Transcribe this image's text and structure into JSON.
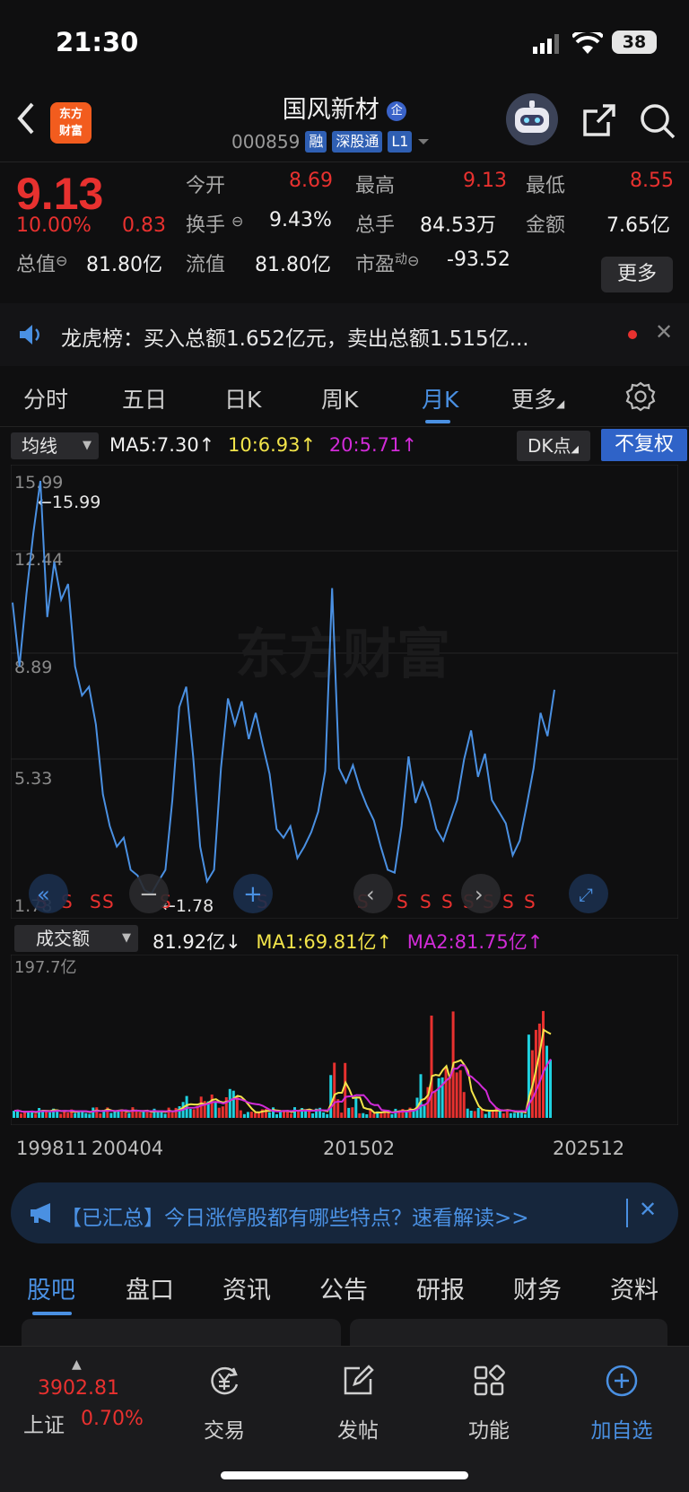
{
  "status_bar": {
    "time": "21:30",
    "battery": "38"
  },
  "header": {
    "logo_line1": "东方",
    "logo_line2": "财富",
    "stock_name": "国风新材",
    "stock_code": "000859",
    "tags": [
      "融",
      "深股通",
      "L1"
    ]
  },
  "quote": {
    "price": "9.13",
    "change_pct": "10.00%",
    "change_amt": "0.83",
    "open_label": "今开",
    "open": "8.69",
    "high_label": "最高",
    "high": "9.13",
    "low_label": "最低",
    "low": "8.55",
    "turnover_label": "换手",
    "turnover": "9.43%",
    "volume_label": "总手",
    "volume": "84.53万",
    "amount_label": "金额",
    "amount": "7.65亿",
    "mktcap_label": "总值",
    "mktcap": "81.80亿",
    "float_label": "流值",
    "float": "81.80亿",
    "pe_label": "市盈",
    "pe_sup": "动",
    "pe": "-93.52",
    "more_button": "更多"
  },
  "notice": {
    "text": "龙虎榜：买入总额1.652亿元，卖出总额1.515亿..."
  },
  "period_tabs": [
    "分时",
    "五日",
    "日K",
    "周K",
    "月K",
    "更多"
  ],
  "active_period": "月K",
  "ma_row": {
    "dropdown": "均线",
    "ma5": "MA5:7.30↑",
    "ma10": "10:6.93↑",
    "ma20": "20:5.71↑",
    "dk_button": "DK点",
    "adjust_button": "不复权"
  },
  "colors": {
    "up": "#e8312f",
    "down": "#1fd1e0",
    "accent": "#4a90e2",
    "ma_yellow": "#f2e44a",
    "ma_magenta": "#d12bd8",
    "line": "#4a90e2"
  },
  "kline": {
    "y_ticks": [
      "15.99",
      "12.44",
      "8.89",
      "5.33",
      "1.78"
    ],
    "max_label": "←15.99",
    "min_label": "←1.78",
    "watermark": "东方财富",
    "s_markers": [
      "S",
      "S",
      "S",
      "S",
      "S",
      "S",
      "S",
      "S",
      "S",
      "S",
      "S",
      "S",
      "S",
      "S",
      "S",
      "S",
      "S"
    ]
  },
  "volume": {
    "dropdown": "成交额",
    "value": "81.92亿↓",
    "ma1": "MA1:69.81亿↑",
    "ma2": "MA2:81.75亿↑",
    "max_label": "197.7亿"
  },
  "date_labels": [
    "199811",
    "200404",
    "201502",
    "202512"
  ],
  "chart_data": {
    "type": "line",
    "title": "",
    "xlabel": "",
    "ylabel": "",
    "x_ticks": [
      "199811",
      "200404",
      "201502",
      "202512"
    ],
    "ylim": [
      1.78,
      15.99
    ],
    "series": [
      {
        "values": [
          11.8,
          9.6,
          12.1,
          14.2,
          15.99,
          11.3,
          13.2,
          11.9,
          12.44,
          9.6,
          8.6,
          8.9,
          7.6,
          5.2,
          4.1,
          3.4,
          3.7,
          2.6,
          2.4,
          1.9,
          1.78,
          2.2,
          2.6,
          5.0,
          8.2,
          8.9,
          6.5,
          3.4,
          2.2,
          2.6,
          6.1,
          8.5,
          7.6,
          8.4,
          7.1,
          8.0,
          6.9,
          5.9,
          4.0,
          3.7,
          4.1,
          3.0,
          3.4,
          3.9,
          4.6,
          6.0,
          12.3,
          6.1,
          5.6,
          6.2,
          5.4,
          4.8,
          4.3,
          3.4,
          2.6,
          2.5,
          4.1,
          6.5,
          4.9,
          5.6,
          5.0,
          4.0,
          3.6,
          4.3,
          5.0,
          6.4,
          7.4,
          5.8,
          6.6,
          5.0,
          4.6,
          4.2,
          3.1,
          3.6,
          4.8,
          6.1,
          8.0,
          7.2,
          8.8
        ]
      }
    ]
  },
  "banner": {
    "text": "【已汇总】今日涨停股都有哪些特点？速看解读>>"
  },
  "section_tabs": [
    "股吧",
    "盘口",
    "资讯",
    "公告",
    "研报",
    "财务",
    "资料"
  ],
  "bottom_nav": {
    "index_value": "3902.81",
    "index_name": "上证",
    "index_change": "0.70%",
    "trade": "交易",
    "post": "发帖",
    "function": "功能",
    "add_watch": "加自选"
  }
}
